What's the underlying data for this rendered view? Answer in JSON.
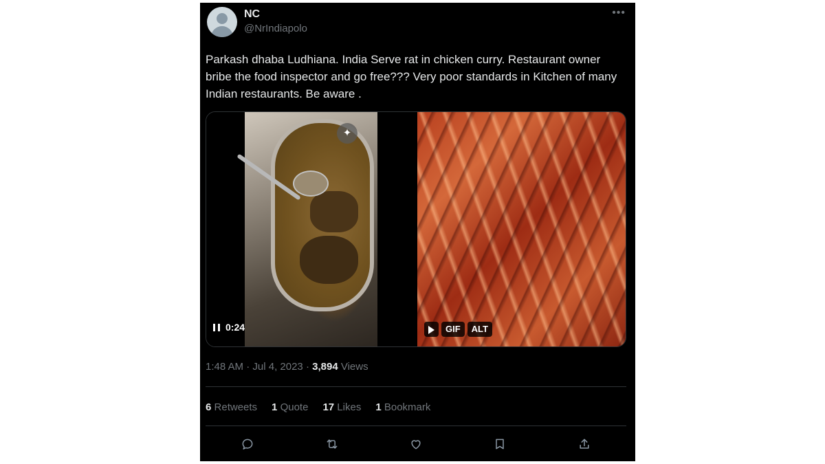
{
  "author": {
    "display_name": "NC",
    "handle": "@NrIndiapolo"
  },
  "more_icon": "more-horizontal-icon",
  "tweet": {
    "text": "Parkash dhaba Ludhiana. India Serve rat in chicken curry. Restaurant owner bribe the food inspector and go free??? Very poor standards in Kitchen of many Indian restaurants. Be aware ."
  },
  "media": {
    "video": {
      "duration": "0:24",
      "sparkle_icon": "sparkle-icon",
      "control_icon": "pause-icon"
    },
    "gif": {
      "gif_label": "GIF",
      "alt_label": "ALT",
      "play_icon": "play-icon"
    }
  },
  "meta": {
    "time": "1:48 AM",
    "separator": "·",
    "date": "Jul 4, 2023",
    "views_count": "3,894",
    "views_label": "Views"
  },
  "stats": {
    "retweets_count": "6",
    "retweets_label": "Retweets",
    "quotes_count": "1",
    "quotes_label": "Quote",
    "likes_count": "17",
    "likes_label": "Likes",
    "bookmarks_count": "1",
    "bookmarks_label": "Bookmark"
  },
  "actions": [
    "reply-icon",
    "retweet-icon",
    "like-icon",
    "bookmark-icon",
    "share-icon"
  ],
  "colors": {
    "background": "#000000",
    "text_primary": "#e7e9ea",
    "text_secondary": "#71767b",
    "divider": "#2f3336"
  }
}
